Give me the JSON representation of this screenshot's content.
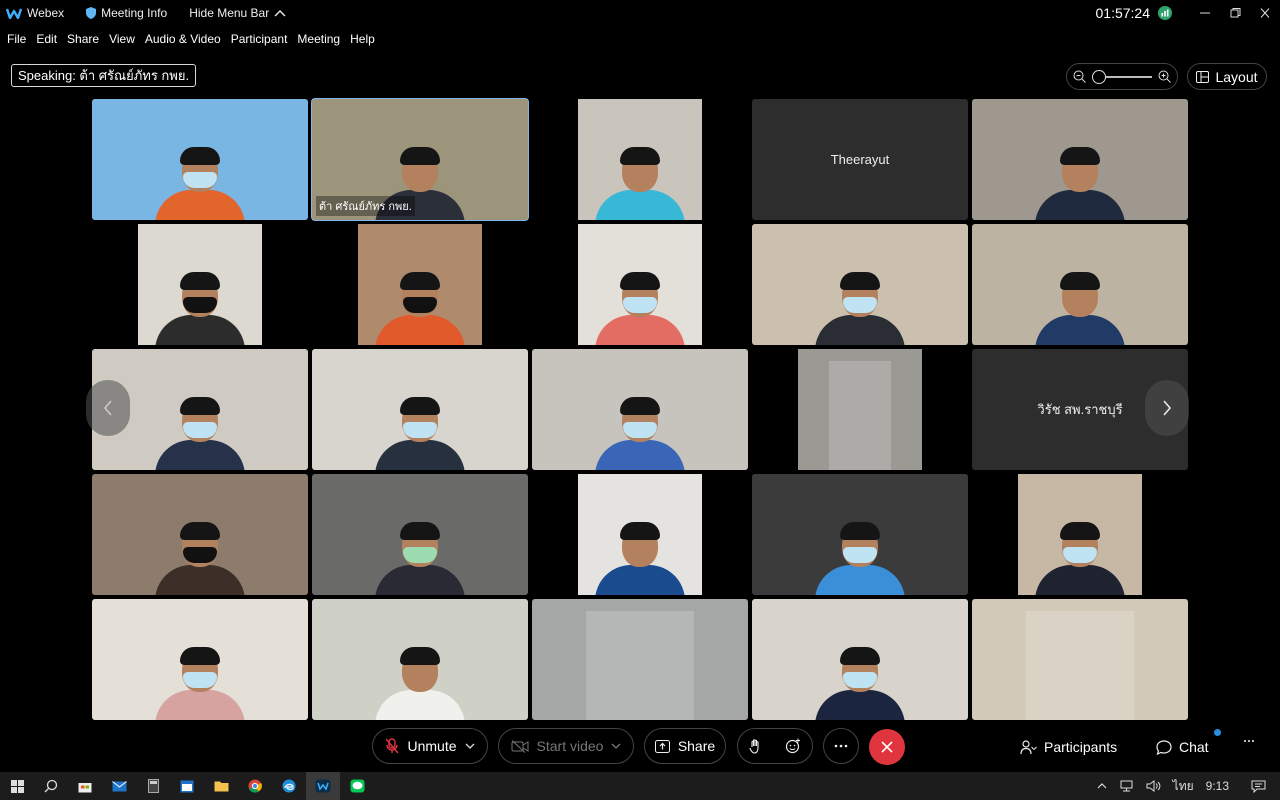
{
  "titlebar": {
    "app_name": "Webex",
    "meeting_info": "Meeting Info",
    "hide_menu": "Hide Menu Bar",
    "clock": "01:57:24",
    "window_controls": [
      "minimize-icon",
      "restore-icon",
      "close-icon"
    ]
  },
  "menu": [
    "File",
    "Edit",
    "Share",
    "View",
    "Audio & Video",
    "Participant",
    "Meeting",
    "Help"
  ],
  "speaking": "Speaking: ต้า ศรัณย์ภัทร กพย.",
  "layout_label": "Layout",
  "tiles": [
    {
      "kind": "video",
      "bg": "#7ab6e3",
      "shirt": "#e2652b",
      "mask": "light",
      "pillar": false
    },
    {
      "kind": "video",
      "bg": "#9c957c",
      "shirt": "#2b2f3a",
      "mask": "none",
      "pillar": false,
      "label": "ต้า ศรัณย์ภัทร กพย.",
      "active": true
    },
    {
      "kind": "video",
      "bg": "#c9c4bc",
      "shirt": "#38b7d7",
      "mask": "none",
      "pillar": true
    },
    {
      "kind": "name",
      "name": "Theerayut"
    },
    {
      "kind": "video",
      "bg": "#9f988e",
      "shirt": "#1f2a3f",
      "mask": "none",
      "pillar": false
    },
    {
      "kind": "video",
      "bg": "#dcd9d1",
      "shirt": "#2c2c2c",
      "mask": "dark",
      "pillar": true
    },
    {
      "kind": "video",
      "bg": "#b08a6c",
      "shirt": "#e05a2c",
      "mask": "dark",
      "pillar": true
    },
    {
      "kind": "video",
      "bg": "#e3e0da",
      "shirt": "#e36d62",
      "mask": "light",
      "pillar": true
    },
    {
      "kind": "video",
      "bg": "#cbbfad",
      "shirt": "#2a2d34",
      "mask": "light",
      "pillar": false
    },
    {
      "kind": "video",
      "bg": "#bdb3a2",
      "shirt": "#1f3b66",
      "mask": "none",
      "pillar": false
    },
    {
      "kind": "video",
      "bg": "#cfcac2",
      "shirt": "#25324a",
      "mask": "light",
      "pillar": false
    },
    {
      "kind": "video",
      "bg": "#d8d5ce",
      "shirt": "#26303e",
      "mask": "light",
      "pillar": false
    },
    {
      "kind": "video",
      "bg": "#c7c4bd",
      "shirt": "#3a66b8",
      "mask": "light",
      "pillar": false
    },
    {
      "kind": "video",
      "bg": "#9a9994",
      "shirt": "#9a9994",
      "mask": "none",
      "pillar": true,
      "empty": true
    },
    {
      "kind": "name",
      "name": "วิรัช สพ.ราชบุรี"
    },
    {
      "kind": "video",
      "bg": "#8d7c6b",
      "shirt": "#3b2f27",
      "mask": "dark",
      "pillar": false
    },
    {
      "kind": "video",
      "bg": "#6a6a68",
      "shirt": "#2a2a35",
      "mask": "green",
      "pillar": false
    },
    {
      "kind": "video",
      "bg": "#e5e3df",
      "shirt": "#1b4b8f",
      "mask": "none",
      "pillar": true
    },
    {
      "kind": "video",
      "bg": "#3b3b3c",
      "shirt": "#3a8fd8",
      "mask": "light",
      "pillar": false
    },
    {
      "kind": "video",
      "bg": "#c6b8a4",
      "shirt": "#1f2330",
      "mask": "light",
      "pillar": true
    },
    {
      "kind": "video",
      "bg": "#e4e0d8",
      "shirt": "#d6a3a0",
      "mask": "light",
      "pillar": false
    },
    {
      "kind": "video",
      "bg": "#cfd0c6",
      "shirt": "#f0f0ec",
      "mask": "none",
      "pillar": false
    },
    {
      "kind": "video",
      "bg": "#a5a7a6",
      "shirt": "#a5a7a6",
      "mask": "none",
      "pillar": false,
      "empty": true
    },
    {
      "kind": "video",
      "bg": "#d9d4cb",
      "shirt": "#1b2540",
      "mask": "light",
      "pillar": false
    },
    {
      "kind": "video",
      "bg": "#d2c9b9",
      "shirt": "#d2c9b9",
      "mask": "none",
      "pillar": false,
      "empty": true
    }
  ],
  "controls": {
    "unmute": "Unmute",
    "start_video": "Start video",
    "share": "Share",
    "participants": "Participants",
    "chat": "Chat"
  },
  "taskbar": {
    "language": "ไทย",
    "time": "9:13"
  },
  "colors": {
    "end_call": "#e0353f",
    "active_tile_border": "#7fb5e6",
    "status_green": "#2ea36b"
  }
}
